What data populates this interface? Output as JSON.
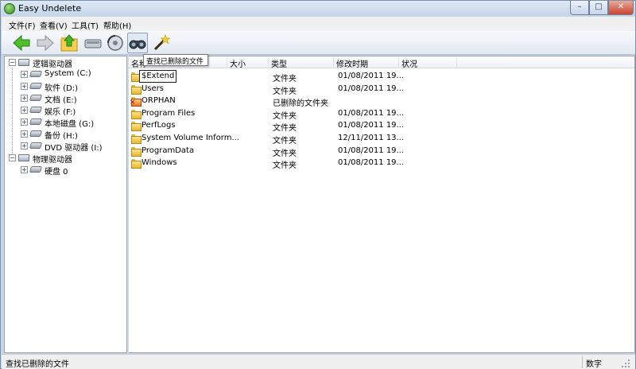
{
  "window": {
    "title": "Easy Undelete",
    "minimize": "–",
    "maximize": "□",
    "close": "✕"
  },
  "menu": [
    "文件(F)",
    "查看(V)",
    "工具(T)",
    "帮助(H)"
  ],
  "toolbar": {
    "buttons": [
      {
        "name": "back-button",
        "icon": "arrow-left-icon"
      },
      {
        "name": "forward-button",
        "icon": "arrow-right-icon"
      },
      {
        "name": "up-folder-button",
        "icon": "folder-up-icon"
      },
      {
        "name": "drive-button",
        "icon": "drive-icon"
      },
      {
        "name": "scan-button",
        "icon": "scan-disk-icon"
      },
      {
        "name": "find-deleted-button",
        "icon": "binoculars-icon"
      },
      {
        "name": "wizard-button",
        "icon": "magic-wand-icon"
      }
    ],
    "tooltip": "查找已删除的文件"
  },
  "tree": {
    "logical_root": "逻辑驱动器",
    "logical_drives": [
      "System (C:)",
      "软件 (D:)",
      "文档 (E:)",
      "娱乐 (F:)",
      "本地磁盘 (G:)",
      "备份 (H:)",
      "DVD 驱动器 (I:)"
    ],
    "physical_root": "物理驱动器",
    "physical_drives": [
      "硬盘 0"
    ],
    "expand_symbol": "+",
    "collapse_symbol": "−"
  },
  "list": {
    "columns": [
      "名称",
      "大小",
      "类型",
      "修改时期",
      "状况"
    ],
    "rows": [
      {
        "name": "$Extend",
        "size": "",
        "type": "文件夹",
        "modified": "01/08/2011   19...",
        "status": "",
        "deleted": false
      },
      {
        "name": "Users",
        "size": "",
        "type": "文件夹",
        "modified": "01/08/2011   19...",
        "status": "",
        "deleted": false
      },
      {
        "name": "ORPHAN",
        "size": "",
        "type": "已删除的文件夹",
        "modified": "",
        "status": "",
        "deleted": true
      },
      {
        "name": "Program Files",
        "size": "",
        "type": "文件夹",
        "modified": "01/08/2011   19...",
        "status": "",
        "deleted": false
      },
      {
        "name": "PerfLogs",
        "size": "",
        "type": "文件夹",
        "modified": "01/08/2011   19...",
        "status": "",
        "deleted": false
      },
      {
        "name": "System Volume Inform...",
        "size": "",
        "type": "文件夹",
        "modified": "12/11/2011   13...",
        "status": "",
        "deleted": false
      },
      {
        "name": "ProgramData",
        "size": "",
        "type": "文件夹",
        "modified": "01/08/2011   19...",
        "status": "",
        "deleted": false
      },
      {
        "name": "Windows",
        "size": "",
        "type": "文件夹",
        "modified": "01/08/2011   19...",
        "status": "",
        "deleted": false
      }
    ]
  },
  "status": {
    "text": "查找已删除的文件",
    "mode": "数字"
  }
}
